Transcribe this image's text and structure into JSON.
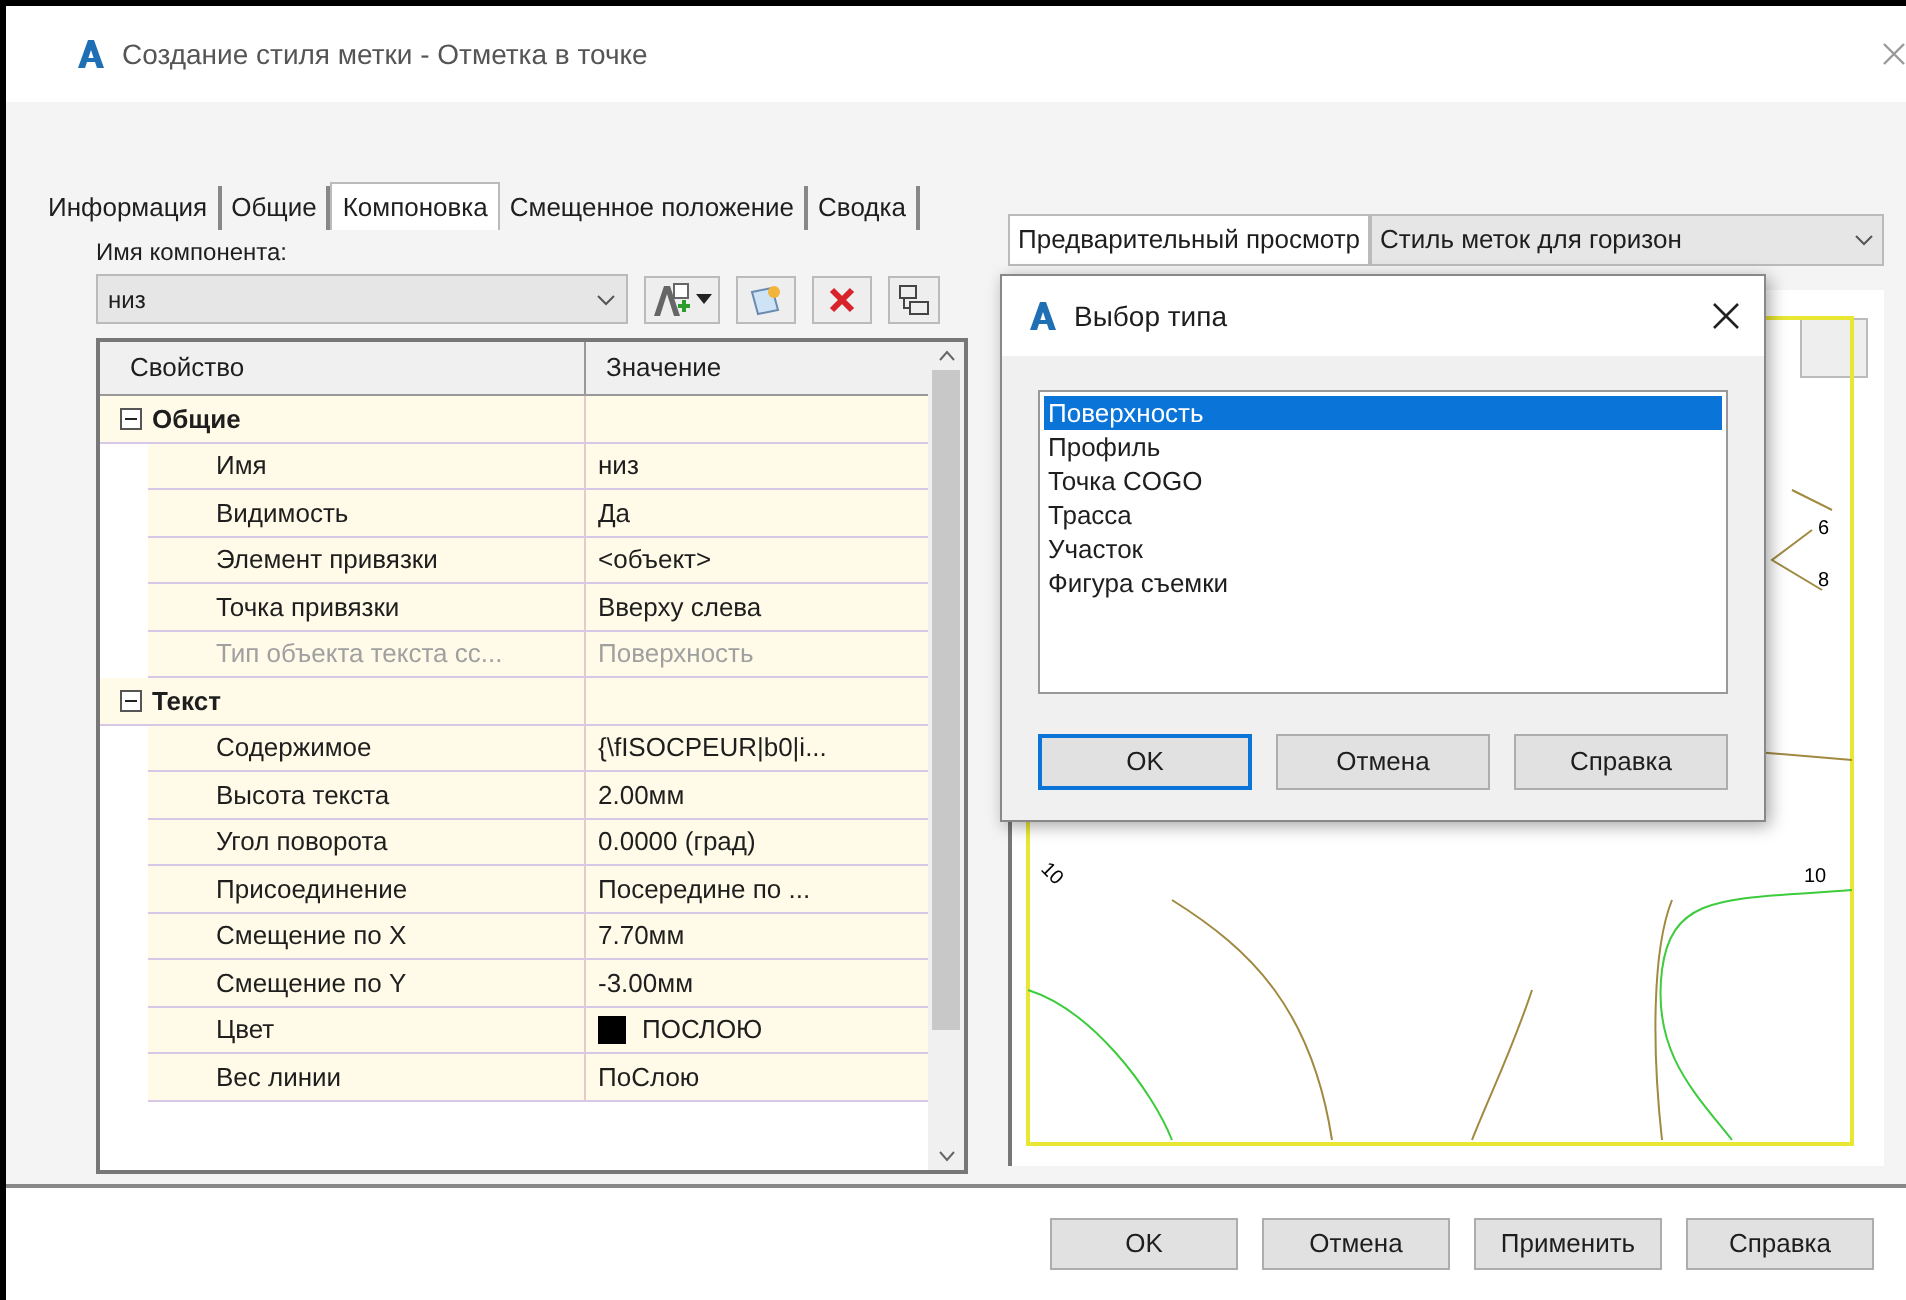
{
  "window": {
    "title": "Создание стиля метки - Отметка в точке"
  },
  "tabs": [
    {
      "label": "Информация",
      "selected": false
    },
    {
      "label": "Общие",
      "selected": false
    },
    {
      "label": "Компоновка",
      "selected": true
    },
    {
      "label": "Смещенное положение",
      "selected": false
    },
    {
      "label": "Сводка",
      "selected": false
    }
  ],
  "component": {
    "label": "Имя компонента:",
    "value": "низ"
  },
  "properties": {
    "columns": [
      "Свойство",
      "Значение"
    ],
    "groups": [
      {
        "name": "Общие",
        "expanded": true,
        "rows": [
          {
            "name": "Имя",
            "value": "низ",
            "disabled": false
          },
          {
            "name": "Видимость",
            "value": "Да",
            "disabled": false
          },
          {
            "name": "Элемент привязки",
            "value": "<объект>",
            "disabled": false
          },
          {
            "name": "Точка привязки",
            "value": "Вверху слева",
            "disabled": false
          },
          {
            "name": "Тип объекта текста сс...",
            "value": "Поверхность",
            "disabled": true
          }
        ]
      },
      {
        "name": "Текст",
        "expanded": true,
        "rows": [
          {
            "name": "Содержимое",
            "value": "{\\fISOCPEUR|b0|i...",
            "disabled": false
          },
          {
            "name": "Высота текста",
            "value": "2.00мм",
            "disabled": false
          },
          {
            "name": "Угол поворота",
            "value": "0.0000 (град)",
            "disabled": false
          },
          {
            "name": "Присоединение",
            "value": "Посередине по ...",
            "disabled": false
          },
          {
            "name": "Смещение по X",
            "value": "7.70мм",
            "disabled": false
          },
          {
            "name": "Смещение по Y",
            "value": "-3.00мм",
            "disabled": false
          },
          {
            "name": "Цвет",
            "value": "ПОСЛОЮ",
            "disabled": false,
            "color": "#000000"
          },
          {
            "name": "Вес линии",
            "value": "ПоСлою",
            "disabled": false
          }
        ]
      }
    ]
  },
  "preview": {
    "button": "Предварительный просмотр",
    "style": "Стиль меток для горизон",
    "contour_labels": [
      "6",
      "8",
      "10",
      "10"
    ]
  },
  "type_dialog": {
    "title": "Выбор типа",
    "items": [
      {
        "label": "Поверхность",
        "selected": true
      },
      {
        "label": "Профиль",
        "selected": false
      },
      {
        "label": "Точка COGO",
        "selected": false
      },
      {
        "label": "Трасса",
        "selected": false
      },
      {
        "label": "Участок",
        "selected": false
      },
      {
        "label": "Фигура съемки",
        "selected": false
      }
    ],
    "buttons": [
      {
        "label": "OK",
        "focused": true
      },
      {
        "label": "Отмена",
        "focused": false
      },
      {
        "label": "Справка",
        "focused": false
      }
    ]
  },
  "buttons": [
    "OK",
    "Отмена",
    "Применить",
    "Справка"
  ]
}
